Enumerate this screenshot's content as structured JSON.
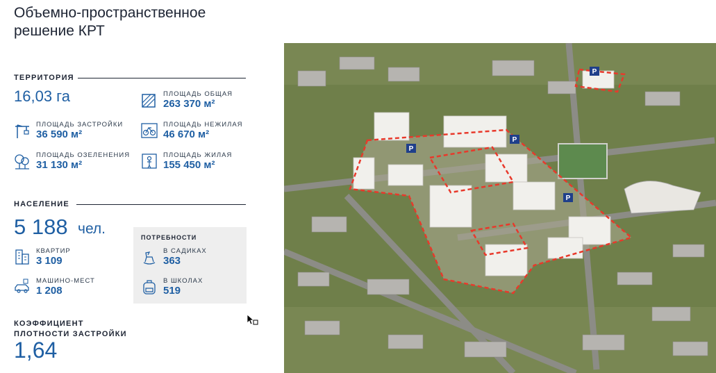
{
  "title_line1": "Объемно-пространственное",
  "title_line2": "решение КРТ",
  "territory": {
    "label": "ТЕРРИТОРИЯ",
    "area": "16,03 га",
    "stats": [
      {
        "label": "ПЛОЩАДЬ ОБЩАЯ",
        "value": "263 370 м²",
        "icon": "area-icon"
      },
      {
        "label": "ПЛОЩАДЬ ЗАСТРОЙКИ",
        "value": "36 590 м²",
        "icon": "crane-icon"
      },
      {
        "label": "ПЛОЩАДЬ НЕЖИЛАЯ",
        "value": "46 670 м²",
        "icon": "bicycle-icon"
      },
      {
        "label": "ПЛОЩАДЬ ОЗЕЛЕНЕНИЯ",
        "value": "31 130 м²",
        "icon": "trees-icon"
      },
      {
        "label": "ПЛОЩАДЬ ЖИЛАЯ",
        "value": "155 450 м²",
        "icon": "person-door-icon"
      }
    ]
  },
  "population": {
    "label": "НАСЕЛЕНИЕ",
    "count": "5 188",
    "unit": "чел.",
    "apartments_label": "КВАРТИР",
    "apartments_value": "3 109",
    "parking_label": "МАШИНО-МЕСТ",
    "parking_value": "1 208"
  },
  "needs": {
    "title": "ПОТРЕБНОСТИ",
    "kindergarten_label": "В САДИКАХ",
    "kindergarten_value": "363",
    "school_label": "В ШКОЛАХ",
    "school_value": "519"
  },
  "density": {
    "label_line1": "КОЭФФИЦИЕНТ",
    "label_line2": "ПЛОТНОСТИ ЗАСТРОЙКИ",
    "value": "1,64"
  },
  "map": {
    "parking_marker": "P",
    "boundary_color": "#e8392b",
    "grass_color": "#6f7f4a"
  }
}
